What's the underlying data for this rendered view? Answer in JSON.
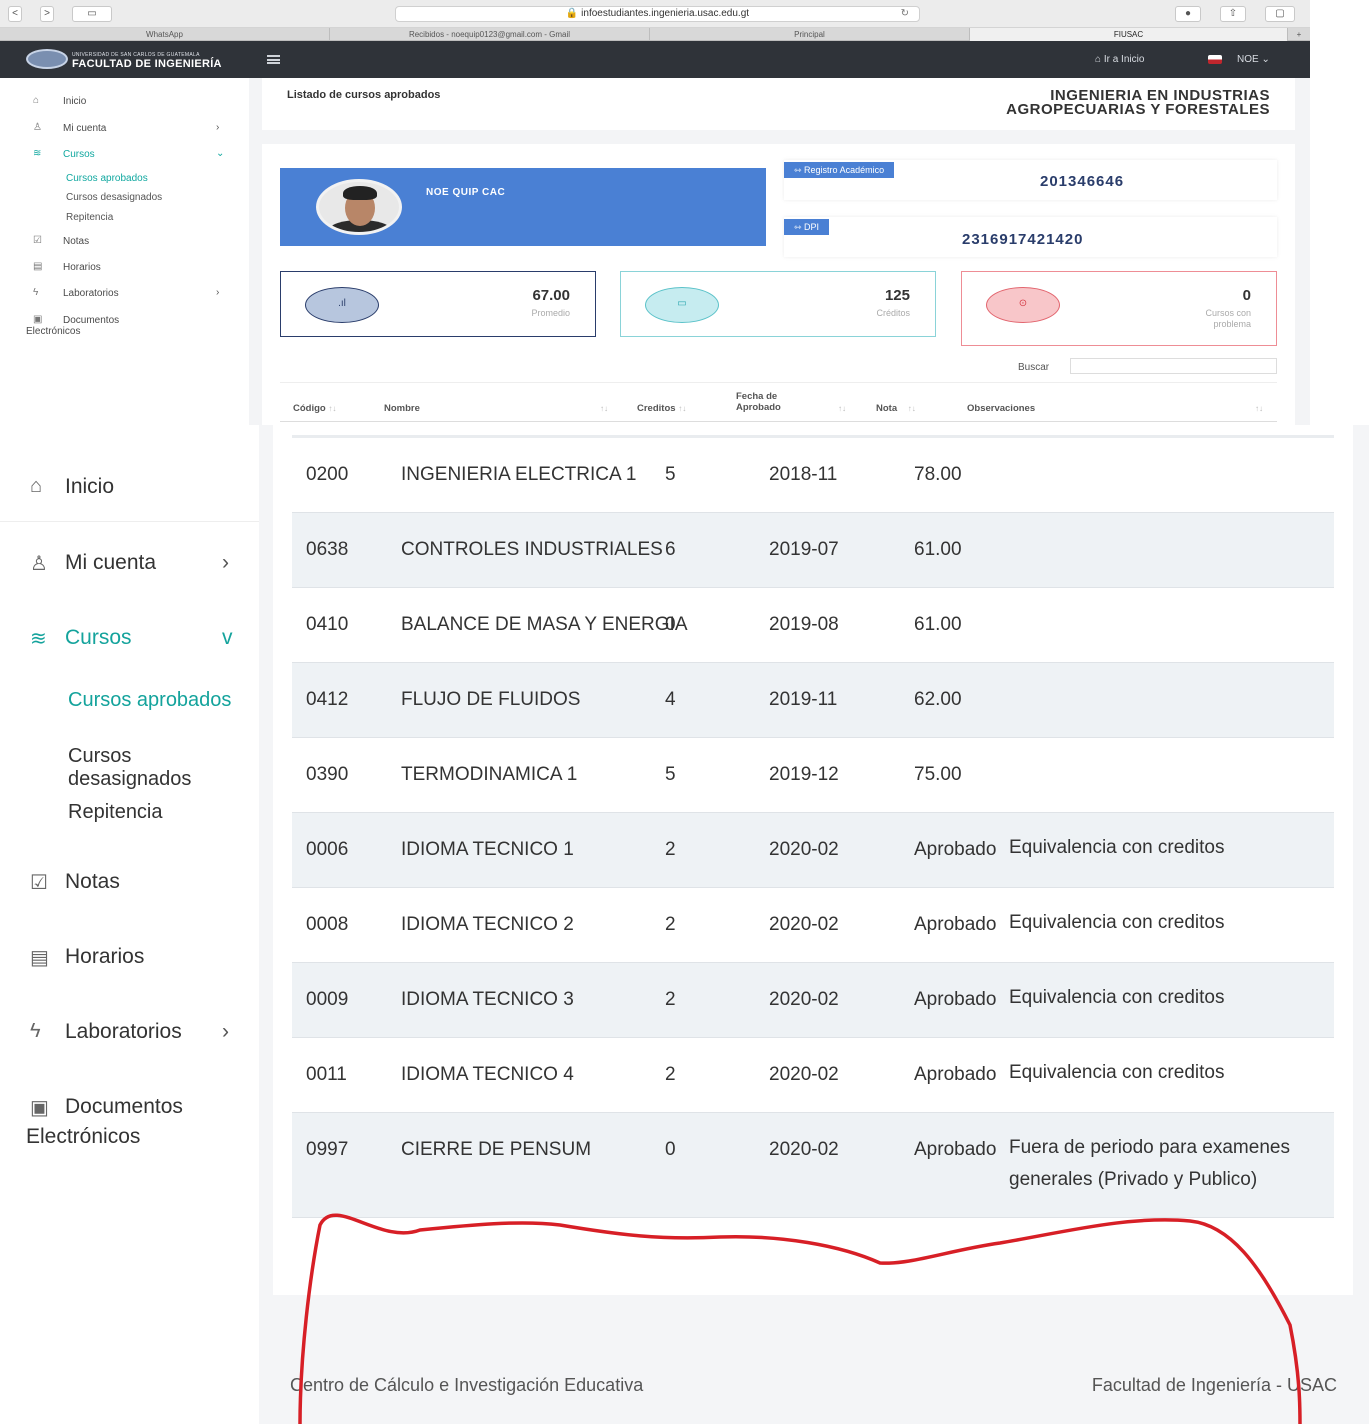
{
  "browser": {
    "url": "infoestudiantes.ingenieria.usac.edu.gt",
    "tabs": [
      "WhatsApp",
      "Recibidos - noequip0123@gmail.com - Gmail",
      "Principal",
      "FIUSAC"
    ]
  },
  "header": {
    "university": "UNIVERSIDAD DE SAN CARLOS DE GUATEMALA",
    "faculty": "FACULTAD DE INGENIERÍA",
    "go_home": "Ir a Inicio",
    "user": "NOE"
  },
  "sidebar": {
    "inicio": "Inicio",
    "mi_cuenta": "Mi cuenta",
    "cursos": "Cursos",
    "cursos_aprobados": "Cursos aprobados",
    "cursos_desasignados": "Cursos desasignados",
    "repitencia": "Repitencia",
    "notas": "Notas",
    "horarios": "Horarios",
    "laboratorios": "Laboratorios",
    "documentos": "Documentos",
    "electronicos": "Electrónicos"
  },
  "page": {
    "title": "Listado de cursos aprobados",
    "career_line1": "INGENIERIA EN INDUSTRIAS",
    "career_line2": "AGROPECUARIAS Y FORESTALES"
  },
  "student": {
    "name": "NOE QUIP CAC",
    "registro_label": "Registro Académico",
    "registro": "201346646",
    "dpi_label": "DPI",
    "dpi": "2316917421420"
  },
  "stats": {
    "promedio_value": "67.00",
    "promedio_label": "Promedio",
    "creditos_value": "125",
    "creditos_label": "Créditos",
    "problema_value": "0",
    "problema_label1": "Cursos con",
    "problema_label2": "problema"
  },
  "table": {
    "search_label": "Buscar",
    "headers": {
      "codigo": "Código",
      "nombre": "Nombre",
      "creditos": "Creditos",
      "fecha1": "Fecha de",
      "fecha2": "Aprobado",
      "nota": "Nota",
      "observaciones": "Observaciones"
    },
    "rows": [
      {
        "codigo": "0200",
        "nombre": "INGENIERIA ELECTRICA 1",
        "creditos": "5",
        "fecha": "2018-11",
        "nota": "78.00",
        "obs": ""
      },
      {
        "codigo": "0638",
        "nombre": "CONTROLES INDUSTRIALES",
        "creditos": "6",
        "fecha": "2019-07",
        "nota": "61.00",
        "obs": ""
      },
      {
        "codigo": "0410",
        "nombre": "BALANCE DE MASA Y ENERGIA",
        "creditos": "0",
        "fecha": "2019-08",
        "nota": "61.00",
        "obs": ""
      },
      {
        "codigo": "0412",
        "nombre": "FLUJO DE FLUIDOS",
        "creditos": "4",
        "fecha": "2019-11",
        "nota": "62.00",
        "obs": ""
      },
      {
        "codigo": "0390",
        "nombre": "TERMODINAMICA 1",
        "creditos": "5",
        "fecha": "2019-12",
        "nota": "75.00",
        "obs": ""
      },
      {
        "codigo": "0006",
        "nombre": "IDIOMA TECNICO 1",
        "creditos": "2",
        "fecha": "2020-02",
        "nota": "Aprobado",
        "obs": "Equivalencia con creditos"
      },
      {
        "codigo": "0008",
        "nombre": "IDIOMA TECNICO 2",
        "creditos": "2",
        "fecha": "2020-02",
        "nota": "Aprobado",
        "obs": "Equivalencia con creditos"
      },
      {
        "codigo": "0009",
        "nombre": "IDIOMA TECNICO 3",
        "creditos": "2",
        "fecha": "2020-02",
        "nota": "Aprobado",
        "obs": "Equivalencia con creditos"
      },
      {
        "codigo": "0011",
        "nombre": "IDIOMA TECNICO 4",
        "creditos": "2",
        "fecha": "2020-02",
        "nota": "Aprobado",
        "obs": "Equivalencia con creditos"
      },
      {
        "codigo": "0997",
        "nombre": "CIERRE DE PENSUM",
        "creditos": "0",
        "fecha": "2020-02",
        "nota": "Aprobado",
        "obs": "Fuera de periodo para examenes generales (Privado y Publico)"
      }
    ]
  },
  "footer": {
    "left": "Centro de Cálculo e Investigación Educativa",
    "right": "Facultad de Ingeniería - USAC"
  },
  "colors": {
    "accent": "#14a39c",
    "profile_blue": "#4a80d4",
    "appbar": "#2f3339",
    "annotation_red": "#d71f26"
  }
}
